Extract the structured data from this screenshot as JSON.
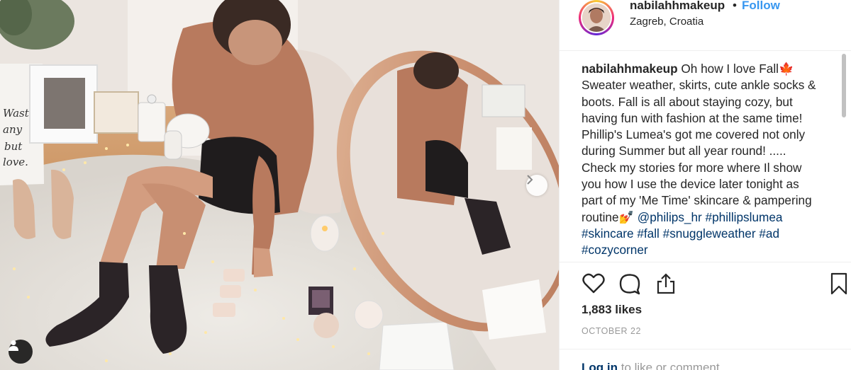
{
  "post": {
    "username": "nabilahhmakeup",
    "separator": "•",
    "follow_label": "Follow",
    "location": "Zagreb, Croatia"
  },
  "caption": {
    "author": "nabilahhmakeup",
    "text": "Oh how I love Fall🍁 Sweater weather, skirts, cute ankle socks & boots. Fall is all about staying cozy, but having fun with fashion at the same time! Phillip's Lumea's got me covered not only during Summer but all year round! ..... Check my stories for more where Il show you how I use the device later tonight as part of my 'Me Time' skincare & pampering routine💅",
    "hashtags": [
      "@philips_hr",
      "#phillipslumea",
      "#skincare",
      "#fall",
      "#snuggleweather",
      "#ad",
      "#cozycorner"
    ]
  },
  "actions": {
    "like_icon": "heart-icon",
    "comment_icon": "comment-icon",
    "share_icon": "share-icon",
    "save_icon": "bookmark-icon"
  },
  "likes": "1,883 likes",
  "date": "OCTOBER 22",
  "login": {
    "link": "Log in",
    "text": "to like or comment."
  },
  "photo": {
    "alt_icon": "user-tag-icon",
    "next_icon": "chevron-right-icon"
  },
  "colors": {
    "accent": "#3897f0",
    "hashtag": "#003569",
    "text": "#262626",
    "muted": "#999999"
  }
}
